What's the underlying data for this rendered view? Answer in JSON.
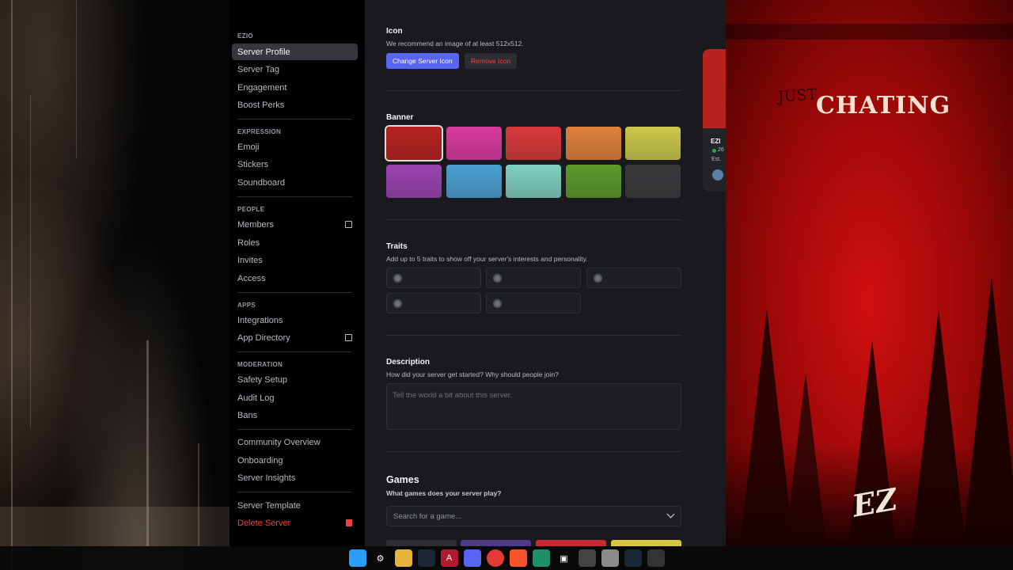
{
  "sidebar": {
    "server_name": "EZIO",
    "items_top": [
      "Server Profile",
      "Server Tag",
      "Engagement",
      "Boost Perks"
    ],
    "expression": {
      "title": "EXPRESSION",
      "items": [
        "Emoji",
        "Stickers",
        "Soundboard"
      ]
    },
    "people": {
      "title": "PEOPLE",
      "items": [
        "Members",
        "Roles",
        "Invites",
        "Access"
      ]
    },
    "apps": {
      "title": "APPS",
      "items": [
        "Integrations",
        "App Directory"
      ]
    },
    "moderation": {
      "title": "MODERATION",
      "items": [
        "Safety Setup",
        "Audit Log",
        "Bans"
      ]
    },
    "community": [
      "Community Overview",
      "Onboarding",
      "Server Insights"
    ],
    "template": "Server Template",
    "delete": "Delete Server"
  },
  "icon_section": {
    "title": "Icon",
    "subtitle": "We recommend an image of at least 512x512.",
    "change_label": "Change Server Icon",
    "remove_label": "Remove Icon"
  },
  "banner_section": {
    "title": "Banner",
    "colors": [
      "#b8221f",
      "#d93a9e",
      "#d8393a",
      "#e0823c",
      "#cdc84a",
      "#9a43b0",
      "#4aa0d2",
      "#7fd0c0",
      "#5c9a2a",
      "#3a3a3d"
    ]
  },
  "traits_section": {
    "title": "Traits",
    "subtitle": "Add up to 5 traits to show off your server's interests and personality."
  },
  "description_section": {
    "title": "Description",
    "subtitle": "How did your server get started? Why should people join?",
    "placeholder": "Tell the world a bit about this server."
  },
  "games_section": {
    "title": "Games",
    "subtitle": "What games does your server play?",
    "placeholder": "Search for a game..."
  },
  "preview": {
    "name": "EZI",
    "members": "26",
    "est": "Est."
  },
  "wallpaper": {
    "text_small": "JUST",
    "text_big": "CHATING",
    "signature": "EZ"
  },
  "colors": {
    "accent": "#5865f2",
    "danger": "#f23f43"
  }
}
